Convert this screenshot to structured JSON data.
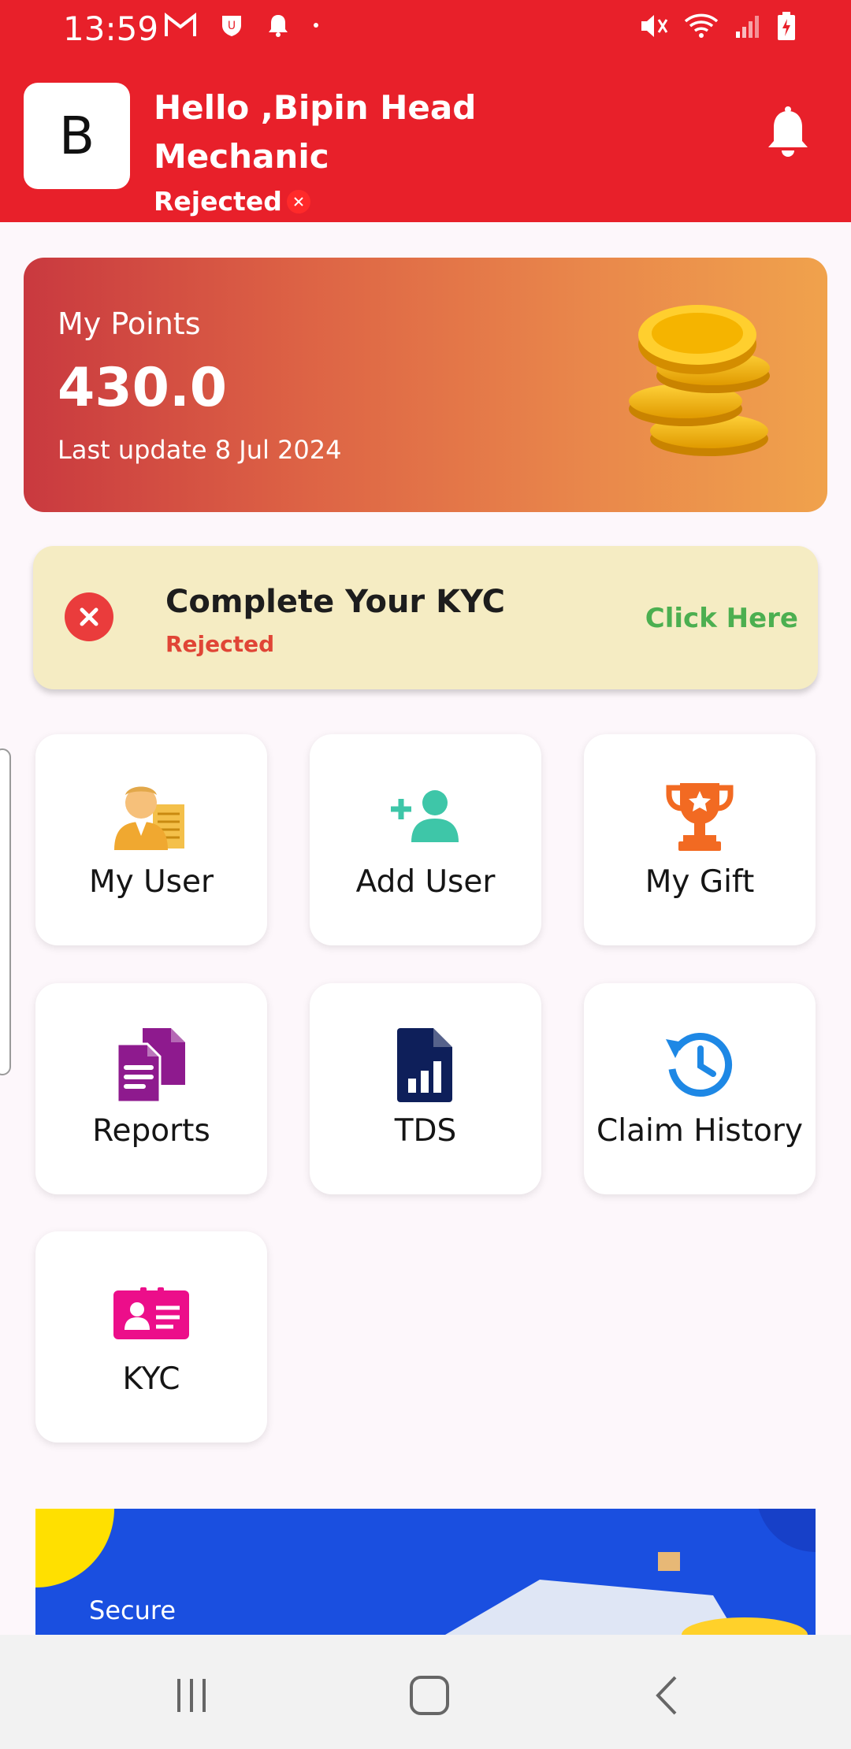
{
  "status_bar": {
    "time": "13:59"
  },
  "header": {
    "avatar_letter": "B",
    "greeting": "Hello ,Bipin Head Mechanic",
    "status": "Rejected"
  },
  "points": {
    "label": "My Points",
    "value": "430.0",
    "last_update": "Last update 8 Jul 2024"
  },
  "kyc_banner": {
    "title": "Complete Your KYC",
    "status": "Rejected",
    "action": "Click Here"
  },
  "tiles": [
    {
      "label": "My User",
      "icon": "user-list-icon",
      "color": "#f0a830"
    },
    {
      "label": "Add User",
      "icon": "add-user-icon",
      "color": "#3ec6a8"
    },
    {
      "label": "My Gift",
      "icon": "trophy-icon",
      "color": "#f26a22"
    },
    {
      "label": "Reports",
      "icon": "documents-icon",
      "color": "#8e1a8e"
    },
    {
      "label": "TDS",
      "icon": "file-chart-icon",
      "color": "#0e1f5a"
    },
    {
      "label": "Claim History",
      "icon": "history-icon",
      "color": "#1e88e5"
    },
    {
      "label": "KYC",
      "icon": "id-card-icon",
      "color": "#ec0e8a"
    }
  ],
  "promo": {
    "text": "Secure"
  },
  "colors": {
    "header": "#e8202a",
    "kyc_banner": "#f5ecc3",
    "success": "#4caf50",
    "error": "#e04536"
  }
}
